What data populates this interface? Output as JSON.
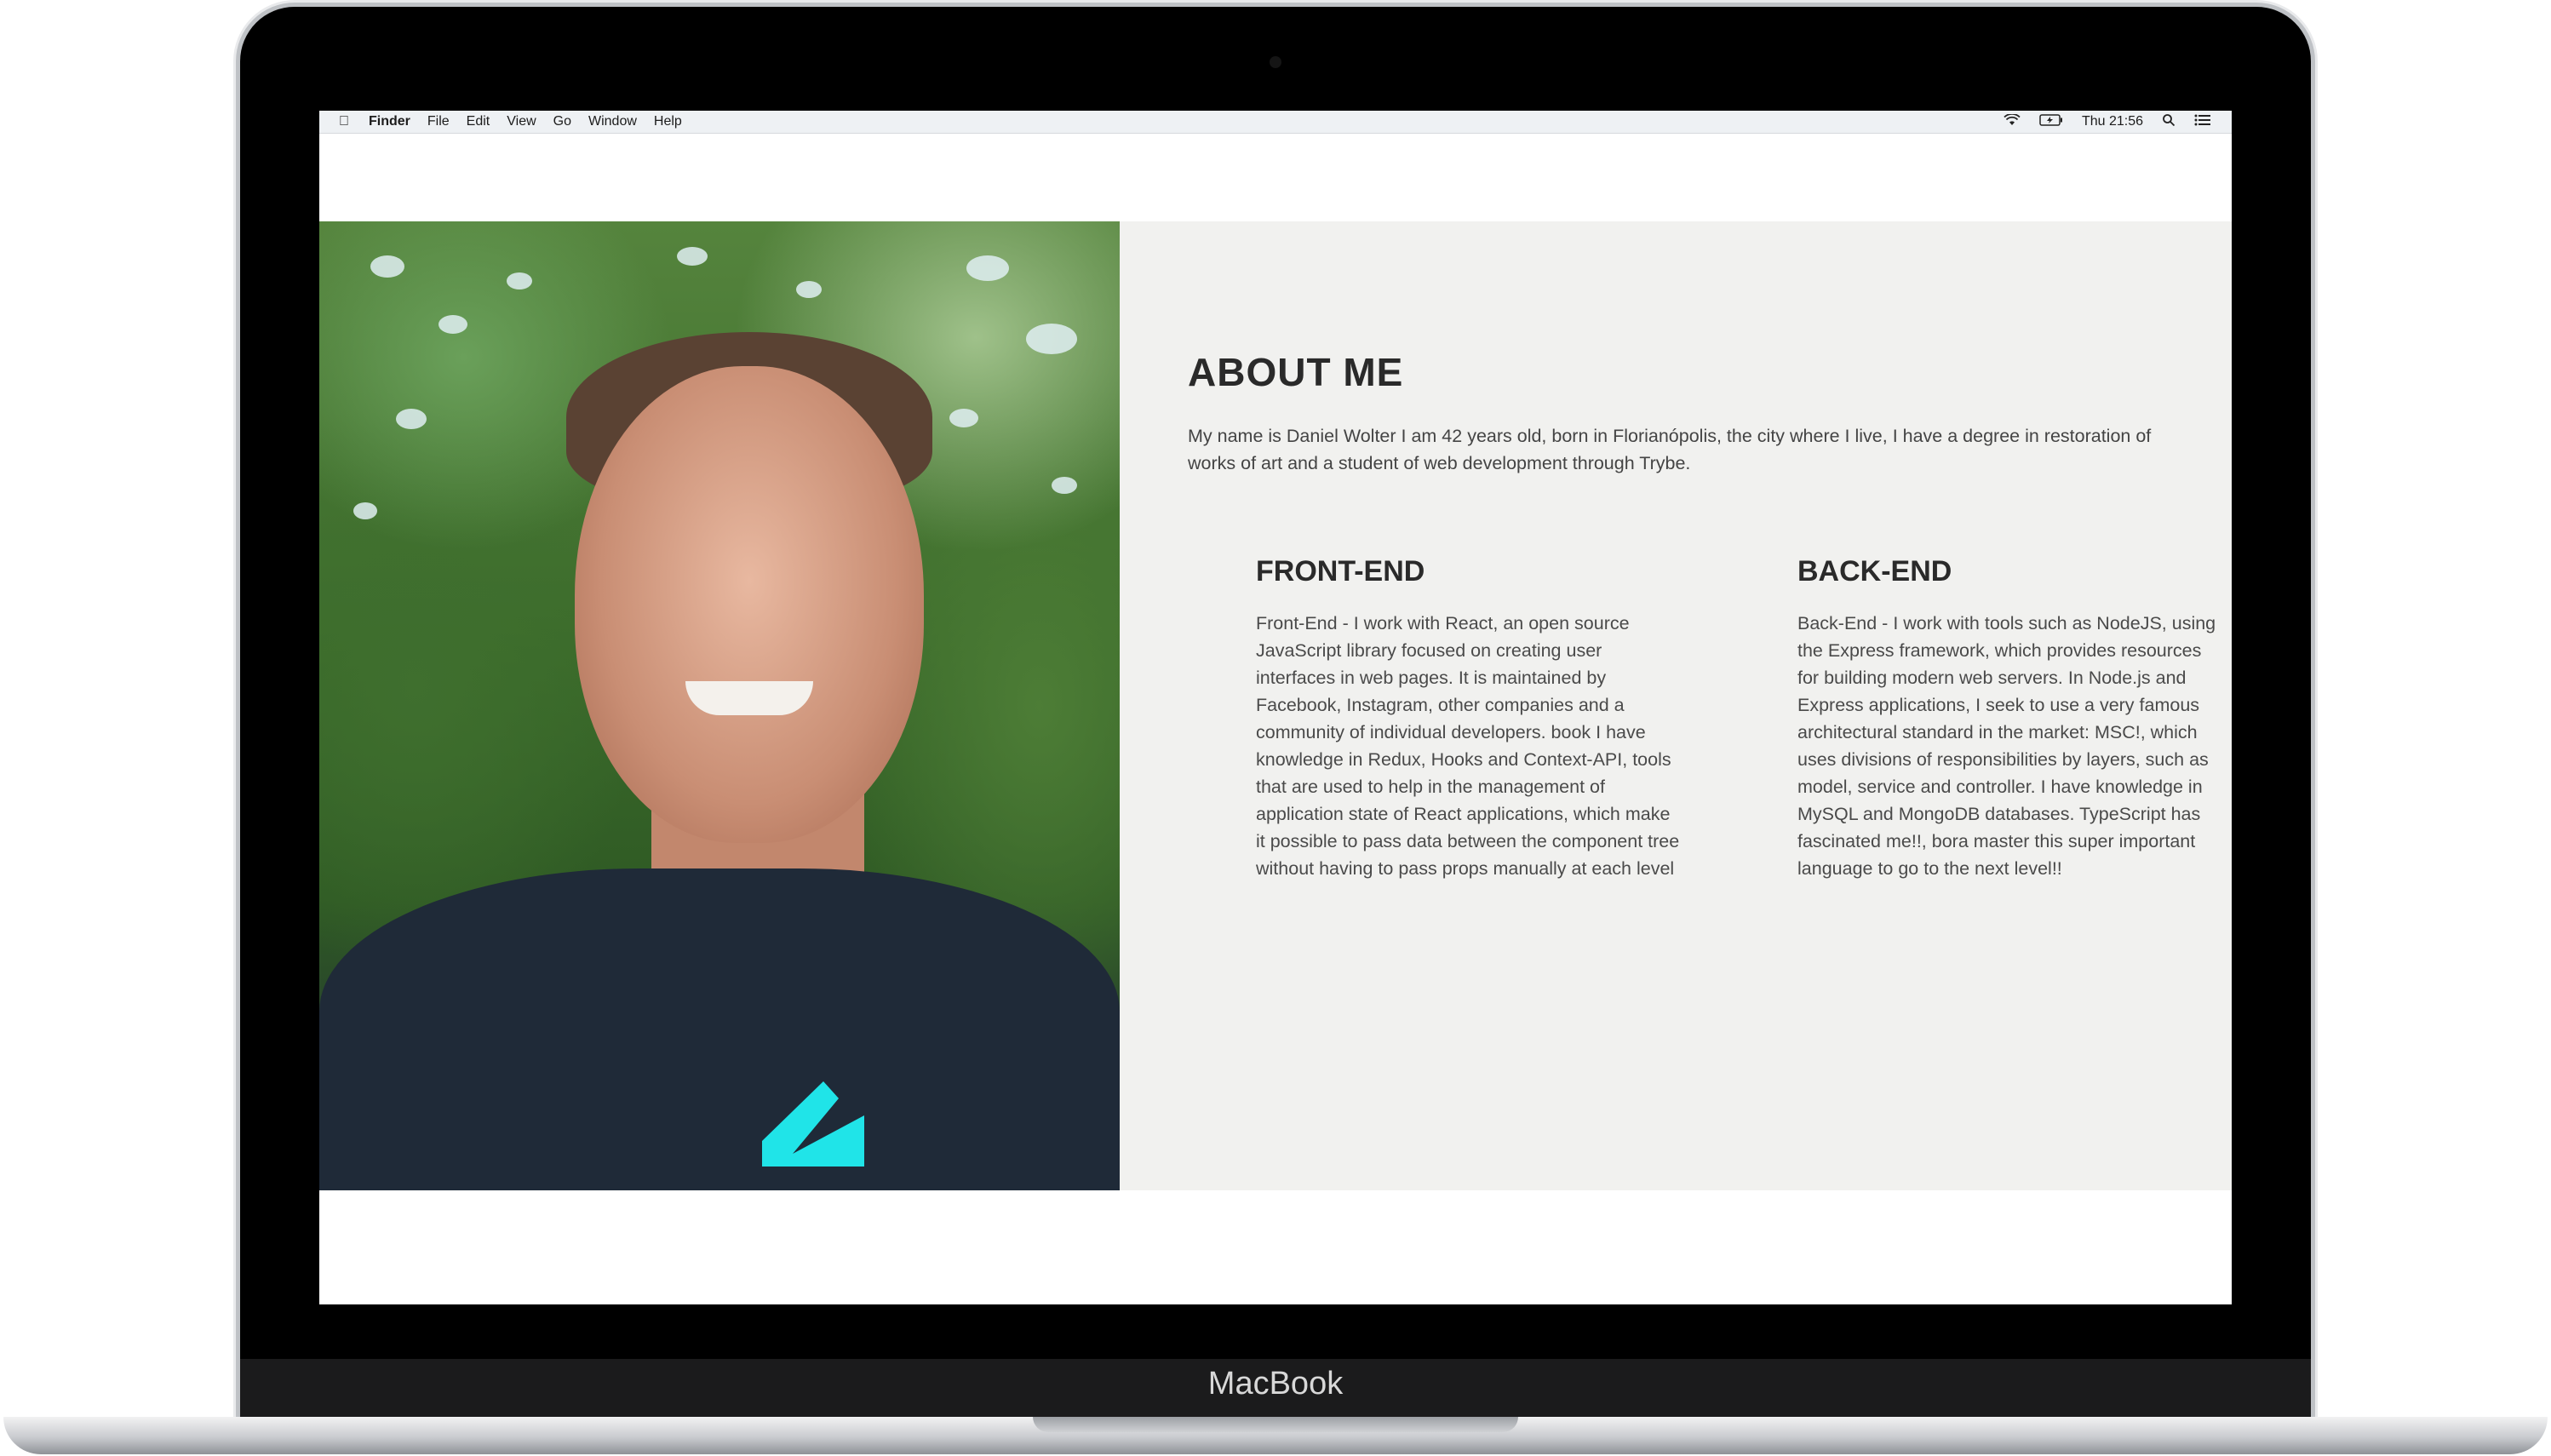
{
  "device": {
    "brand_label": "MacBook"
  },
  "menubar": {
    "apple_icon": "apple-icon",
    "items": [
      "Finder",
      "File",
      "Edit",
      "View",
      "Go",
      "Window",
      "Help"
    ],
    "clock": "Thu 21:56",
    "wifi_icon": "wifi-icon",
    "battery_icon": "battery-icon",
    "spotlight_icon": "search-icon",
    "notifications_icon": "list-icon"
  },
  "about": {
    "title": "ABOUT ME",
    "text": "My name is Daniel Wolter I am 42 years old, born in Florianópolis, the city where I live, I have a degree in restoration of works of art and a student of web development through Trybe."
  },
  "frontend": {
    "title": "FRONT-END",
    "text": "Front-End - I work with React, an open source JavaScript library focused on creating user interfaces in web pages. It is maintained by Facebook, Instagram, other companies and a community of individual developers. book I have knowledge in Redux, Hooks and Context-API, tools that are used to help in the management of application state of React applications, which make it possible to pass data between the component tree without having to pass props manually at each level"
  },
  "backend": {
    "title": "BACK-END",
    "text": "Back-End - I work with tools such as NodeJS, using the Express framework, which provides resources for building modern web servers. In Node.js and Express applications, I seek to use a very famous architectural standard in the market: MSC!, which uses divisions of responsibilities by layers, such as model, service and controller. I have knowledge in MySQL and MongoDB databases. TypeScript has fascinated me!!, bora master this super important language to go to the next level!!"
  },
  "colors": {
    "panel_bg": "#f1f1ef",
    "heading": "#2a2a2a",
    "body_text": "#444444",
    "logo_cyan": "#20e4e8"
  }
}
